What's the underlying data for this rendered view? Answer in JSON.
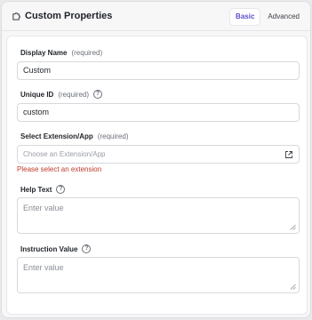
{
  "header": {
    "title": "Custom Properties",
    "icon": "puzzle-icon",
    "tabs": [
      {
        "label": "Basic",
        "active": true
      },
      {
        "label": "Advanced",
        "active": false
      }
    ]
  },
  "form": {
    "display_name": {
      "label": "Display Name",
      "required": "(required)",
      "value": "Custom"
    },
    "unique_id": {
      "label": "Unique ID",
      "required": "(required)",
      "value": "custom"
    },
    "select_extension": {
      "label": "Select Extension/App",
      "required": "(required)",
      "placeholder": "Choose an Extension/App",
      "error": "Please select an extension"
    },
    "help_text": {
      "label": "Help Text",
      "placeholder": "Enter value"
    },
    "instruction_value": {
      "label": "Instruction Value",
      "placeholder": "Enter value"
    }
  },
  "colors": {
    "accent": "#5b50c8",
    "error": "#c0392b"
  }
}
